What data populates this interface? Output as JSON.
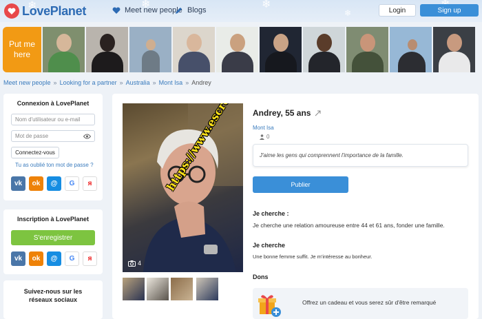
{
  "header": {
    "brand": "LovePlanet",
    "nav": {
      "meet": "Meet new people",
      "blogs": "Blogs"
    },
    "login": "Login",
    "signup": "Sign up"
  },
  "strip": {
    "put_me": "Put me here"
  },
  "breadcrumb": [
    "Meet new people",
    "Looking for a partner",
    "Australia",
    "Mont Isa",
    "Andrey"
  ],
  "login_card": {
    "title": "Connexion à LovePlanet",
    "username_placeholder": "Nom d'utilisateur ou e-mail",
    "password_placeholder": "Mot de passe",
    "connect": "Connectez-vous",
    "forgot": "Tu as oublié ton mot de passe ?"
  },
  "register_card": {
    "title": "Inscription à LovePlanet",
    "button": "S'enregistrer"
  },
  "follow_card": {
    "title": "Suivez-nous sur les réseaux sociaux"
  },
  "social": [
    {
      "icon": "vk-icon",
      "glyph": "vk",
      "color": "#4a76a8"
    },
    {
      "icon": "odnoklassniki-icon",
      "glyph": "ok",
      "color": "#ee8208"
    },
    {
      "icon": "mailru-icon",
      "glyph": "@",
      "color": "#168de2"
    },
    {
      "icon": "google-icon",
      "glyph": "G",
      "color": "#ffffff"
    },
    {
      "icon": "yandex-icon",
      "glyph": "я",
      "color": "#ffffff"
    }
  ],
  "profile": {
    "name": "Andrey, 55 ans",
    "city": "Mont Isa",
    "views": "0",
    "quote": "J'aime les gens qui comprennent l'importance de la famille.",
    "publish": "Publier",
    "photo_count": "4",
    "watermark": "https://www.escrocs-du-web.fr",
    "seek_title": "Je cherche :",
    "seek_text": "Je cherche une relation amoureuse entre 44 et 61 ans, fonder une famille.",
    "seek2_title": "Je cherche",
    "seek2_text": "Une bonne femme suffit. Je m'intéresse au bonheur.",
    "gifts_title": "Dons",
    "gift_text": "Offrez un cadeau et vous serez sûr d'être remarqué"
  },
  "colors": {
    "accent": "#3a8fd8",
    "brand_red": "#e8484a",
    "orange": "#f29a14",
    "green": "#7dc440"
  }
}
